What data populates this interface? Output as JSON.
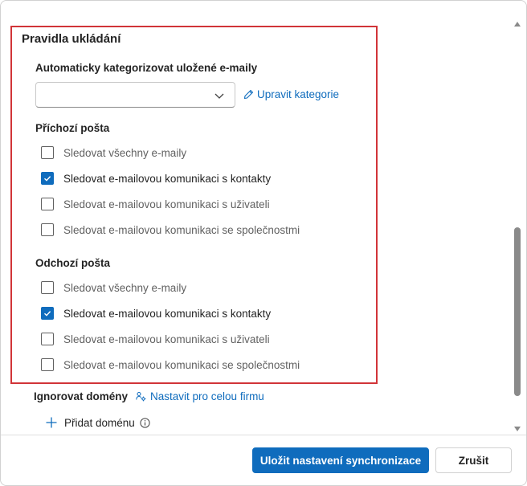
{
  "rules": {
    "title": "Pravidla ukládání",
    "auto_categorize_label": "Automaticky kategorizovat uložené e-maily",
    "category_dropdown_value": "",
    "edit_categories_link": "Upravit kategorie",
    "incoming": {
      "label": "Příchozí pošta",
      "options": [
        {
          "label": "Sledovat všechny e-maily",
          "checked": false
        },
        {
          "label": "Sledovat e-mailovou komunikaci s kontakty",
          "checked": true
        },
        {
          "label": "Sledovat e-mailovou komunikaci s uživateli",
          "checked": false
        },
        {
          "label": "Sledovat e-mailovou komunikaci se společnostmi",
          "checked": false
        }
      ]
    },
    "outgoing": {
      "label": "Odchozí pošta",
      "options": [
        {
          "label": "Sledovat všechny e-maily",
          "checked": false
        },
        {
          "label": "Sledovat e-mailovou komunikaci s kontakty",
          "checked": true
        },
        {
          "label": "Sledovat e-mailovou komunikaci s uživateli",
          "checked": false
        },
        {
          "label": "Sledovat e-mailovou komunikaci se společnostmi",
          "checked": false
        }
      ]
    }
  },
  "ignore_domains": {
    "label": "Ignorovat domény",
    "org_link": "Nastavit pro celou firmu",
    "add_domain": "Přidat doménu"
  },
  "footer": {
    "save_label": "Uložit nastavení synchronizace",
    "cancel_label": "Zrušit"
  },
  "colors": {
    "accent": "#0f6cbd",
    "highlight_border": "#d13438"
  }
}
